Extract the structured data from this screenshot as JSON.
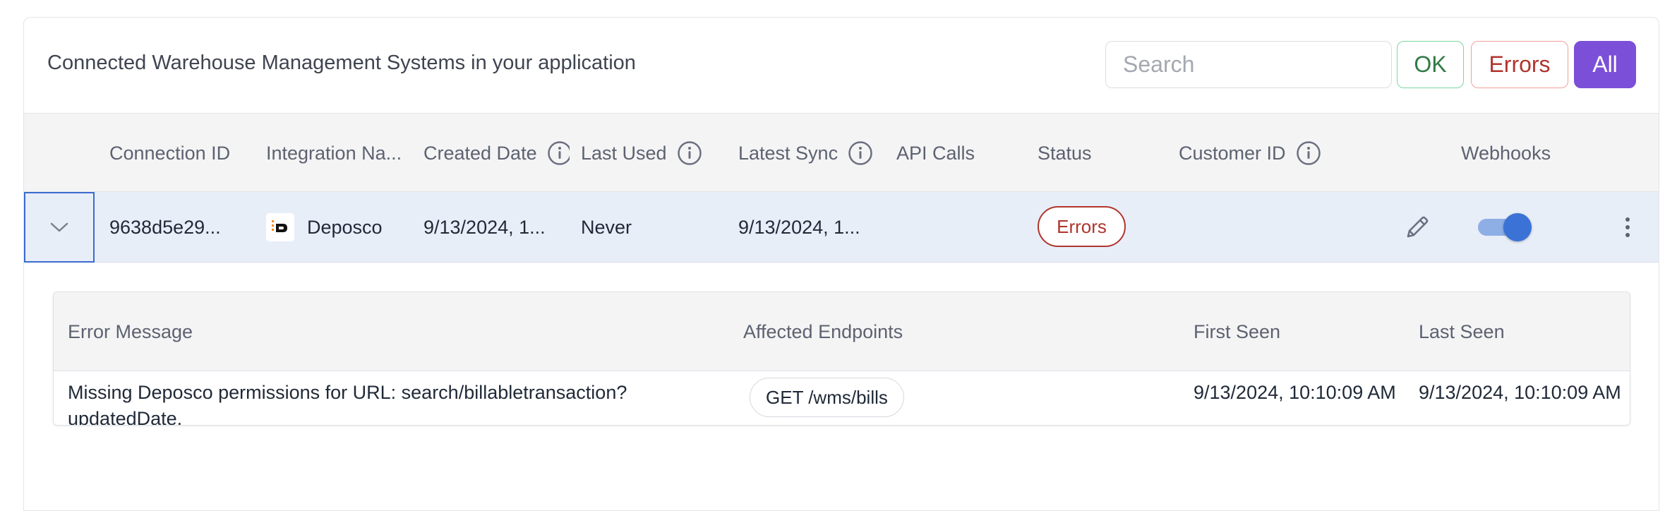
{
  "header": {
    "title": "Connected Warehouse Management Systems in your application",
    "search_placeholder": "Search",
    "filters": {
      "ok": "OK",
      "errors": "Errors",
      "all": "All"
    }
  },
  "columns": {
    "connection_id": "Connection ID",
    "integration_name": "Integration Na...",
    "created_date": "Created Date",
    "last_used": "Last Used",
    "latest_sync": "Latest Sync",
    "api_calls": "API Calls",
    "status": "Status",
    "customer_id": "Customer ID",
    "webhooks": "Webhooks"
  },
  "row": {
    "connection_id": "9638d5e29...",
    "integration_name": "Deposco",
    "created_date": "9/13/2024, 1...",
    "last_used": "Never",
    "latest_sync": "9/13/2024, 1...",
    "api_calls": "",
    "status": "Errors",
    "customer_id": "",
    "webhooks_enabled": true
  },
  "errors_table": {
    "columns": {
      "message": "Error Message",
      "endpoints": "Affected Endpoints",
      "first_seen": "First Seen",
      "last_seen": "Last Seen"
    },
    "rows": [
      {
        "message": "Missing Deposco permissions for URL: search/billabletransaction?updatedDate.",
        "endpoint": "GET /wms/bills",
        "first_seen": "9/13/2024, 10:10:09 AM",
        "last_seen": "9/13/2024, 10:10:09 AM"
      }
    ]
  },
  "colors": {
    "accent": "#7b4fd8",
    "error": "#b0352d",
    "ok": "#2f7a45",
    "selected_row": "#e8eef8",
    "toggle_on": "#3a72d6"
  },
  "icons": {
    "info": "info-circle-icon",
    "expand": "chevron-down-icon",
    "edit": "pencil-icon",
    "menu": "kebab-menu-icon"
  }
}
